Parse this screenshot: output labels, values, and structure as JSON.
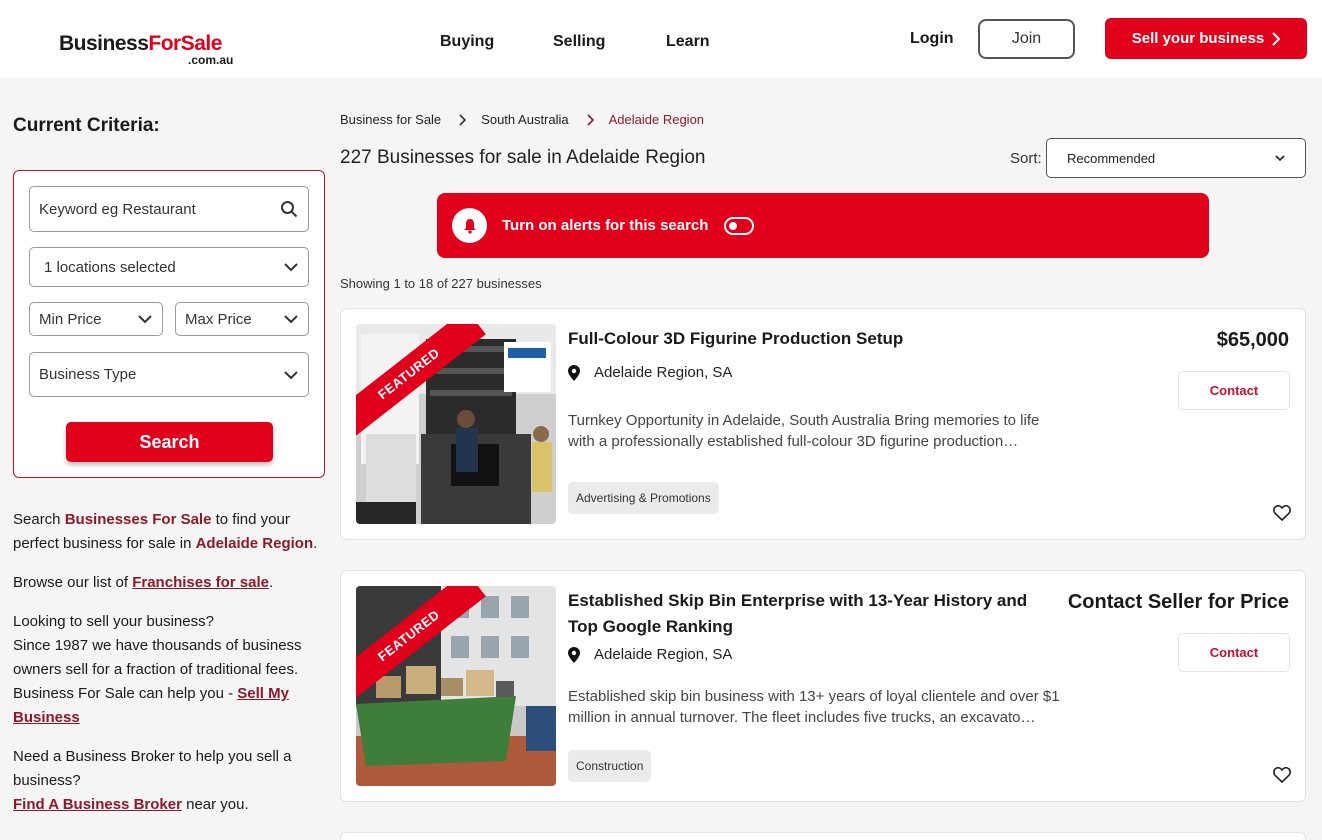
{
  "header": {
    "logo_business": "Business",
    "logo_for": "For",
    "logo_sale": "Sale",
    "logo_domain": ".com.au",
    "nav": [
      "Buying",
      "Selling",
      "Learn"
    ],
    "login": "Login",
    "join": "Join",
    "sell": "Sell your business"
  },
  "sidebar": {
    "title": "Current Criteria:",
    "keyword_placeholder": "Keyword eg Restaurant",
    "locations": "1 locations selected",
    "min_price": "Min Price",
    "max_price": "Max Price",
    "business_type": "Business Type",
    "search_label": "Search",
    "p1_a": "Search ",
    "p1_brand": "Businesses For Sale",
    "p1_b": " to find your perfect business for sale in ",
    "p1_region": "Adelaide Region",
    "p1_c": ".",
    "p2_a": "Browse our list of ",
    "p2_link": "Franchises for sale",
    "p2_b": ".",
    "p3_a": "Looking to sell your business?",
    "p3_b": "Since 1987 we have thousands of business owners sell for a fraction of traditional fees. Business For Sale can help you - ",
    "p3_link": "Sell My Business",
    "p4_a": "Need a Business Broker to help you sell a business?",
    "p4_link": "Find A Business Broker",
    "p4_b": " near you."
  },
  "breadcrumb": [
    "Business for Sale",
    "South Australia",
    "Adelaide Region"
  ],
  "results_title": "227 Businesses for sale in Adelaide Region",
  "sort": {
    "label": "Sort:",
    "value": "Recommended"
  },
  "alert": {
    "text": "Turn on alerts for this search",
    "enabled": false
  },
  "showing": "Showing 1 to 18 of 227 businesses",
  "listings": [
    {
      "badge": "FEATURED",
      "title": "Full-Colour 3D Figurine Production Setup",
      "location": "Adelaide Region, SA",
      "description": "Turnkey Opportunity in Adelaide, South Australia Bring memories to life with a professionally established full-colour 3D figurine production…",
      "tag": "Advertising & Promotions",
      "price": "$65,000",
      "contact": "Contact"
    },
    {
      "badge": "FEATURED",
      "title": "Established Skip Bin Enterprise with 13-Year History and Top Google Ranking",
      "location": "Adelaide Region, SA",
      "description": "Established skip bin business with 13+ years of loyal clientele and over $1 million in annual turnover.  The fleet includes five trucks, an excavato…",
      "tag": "Construction",
      "price": "Contact Seller for Price",
      "contact": "Contact"
    }
  ],
  "colors": {
    "brand_red": "#e0001b",
    "link_maroon": "#8b1a2b"
  }
}
